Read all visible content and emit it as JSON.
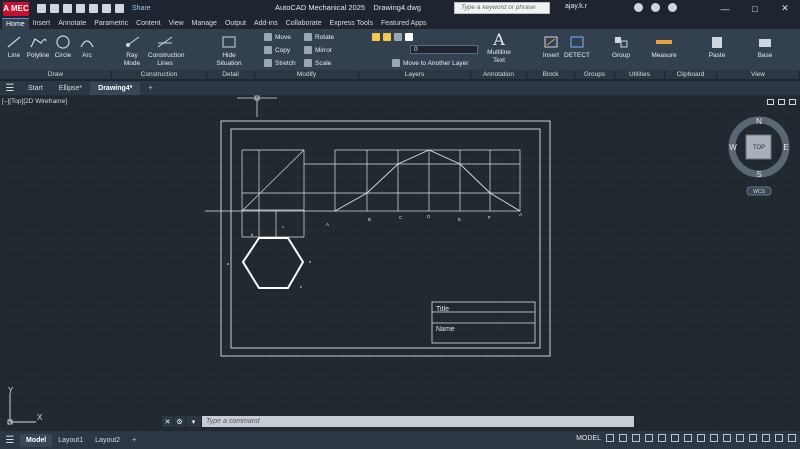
{
  "app": {
    "logo": "A MEC",
    "title": "AutoCAD Mechanical 2025",
    "document": "Drawing4.dwg",
    "share_label": "Share",
    "search_placeholder": "Type a keyword or phrase",
    "user": "ajay.k.r"
  },
  "ribbon_tabs": [
    "Home",
    "Insert",
    "Annotate",
    "Parametric",
    "Content",
    "View",
    "Manage",
    "Output",
    "Add-ins",
    "Collaborate",
    "Express Tools",
    "Featured Apps"
  ],
  "ribbon": {
    "draw": [
      "Line",
      "Polyline",
      "Circle",
      "Arc"
    ],
    "construction": [
      "Ray Mode",
      "Construction Lines"
    ],
    "detail": "Hide Situation",
    "modify": [
      "Move",
      "Rotate",
      "Copy",
      "Mirror",
      "Stretch",
      "Scale"
    ],
    "layer_value": "0",
    "layer_action": "Move to Another Layer",
    "annotation": "Multiline Text",
    "block": [
      "Insert",
      "DETECT"
    ],
    "groups": "Group",
    "utilities": "Measure",
    "clipboard": "Paste",
    "view": "Base"
  },
  "panels": [
    "Draw",
    "Construction",
    "Detail",
    "Modify",
    "Layers",
    "Annotation",
    "Block",
    "Groups",
    "Utilities",
    "Clipboard",
    "View"
  ],
  "file_tabs": [
    "Start",
    "Ellipse*",
    "Drawing4*"
  ],
  "viewport": {
    "label": "[–][Top][2D Wireframe]",
    "viewcube_top": "TOP",
    "compass": {
      "n": "N",
      "s": "S",
      "e": "E",
      "w": "W"
    },
    "wcs": "WCS",
    "point_labels": [
      "A",
      "B",
      "C",
      "D",
      "E",
      "F",
      "A"
    ],
    "titleblock": {
      "title": "Title",
      "name": "Name"
    },
    "ucs": {
      "x": "X",
      "y": "Y"
    }
  },
  "command": {
    "placeholder": "Type a command"
  },
  "layout_tabs": [
    "Model",
    "Layout1",
    "Layout2"
  ],
  "status_label": "MODEL"
}
